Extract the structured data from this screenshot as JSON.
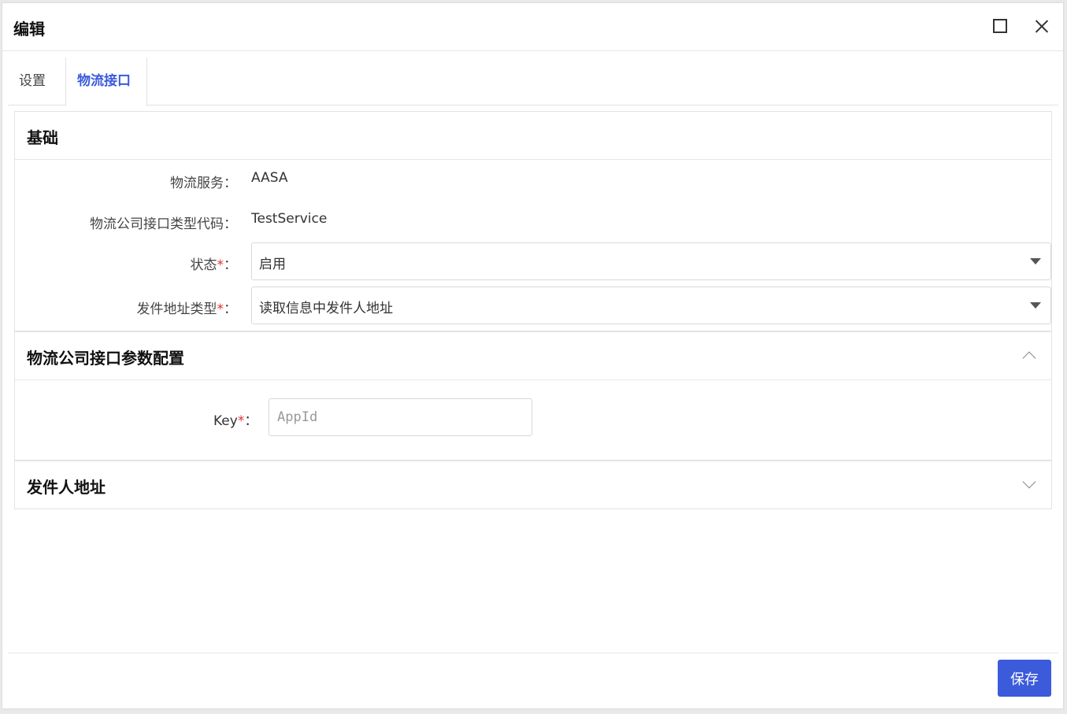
{
  "dialog": {
    "title": "编辑",
    "maximize_icon": "maximize-icon",
    "close_icon": "close-icon"
  },
  "tabs": [
    {
      "label": "设置",
      "active": false
    },
    {
      "label": "物流接口",
      "active": true
    }
  ],
  "basic": {
    "title": "基础",
    "service_label": "物流服务：",
    "service_value": "AASA",
    "type_code_label": "物流公司接口类型代码：",
    "type_code_value": "TestService",
    "status_label": "状态",
    "status_value": "启用",
    "sender_type_label": "发件地址类型",
    "sender_type_value": "读取信息中发件人地址",
    "required_mark": "*",
    "colon": "："
  },
  "params": {
    "title": "物流公司接口参数配置",
    "key_label": "Key",
    "key_placeholder": "AppId",
    "key_value": ""
  },
  "sender": {
    "title": "发件人地址"
  },
  "footer": {
    "save_label": "保存"
  },
  "colors": {
    "accent": "#3b5bdb",
    "required": "#e03131"
  }
}
